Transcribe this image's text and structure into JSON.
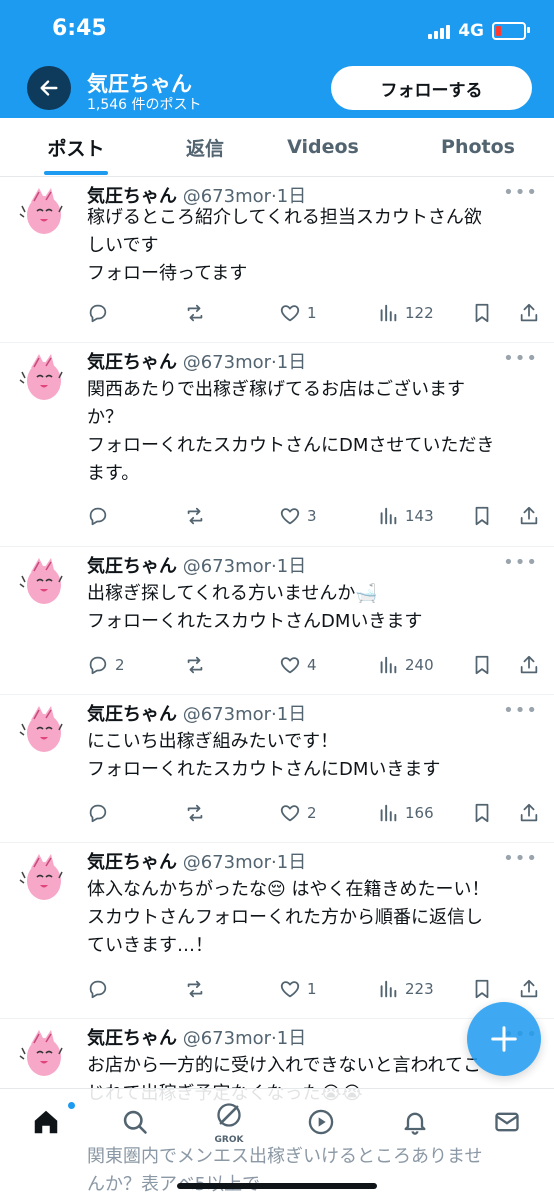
{
  "status_bar": {
    "time": "6:45",
    "network": "4G"
  },
  "header": {
    "name": "気圧ちゃん",
    "post_count": "1,546 件のポスト",
    "follow_label": "フォローする"
  },
  "tabs": [
    {
      "label": "ポスト"
    },
    {
      "label": "返信"
    },
    {
      "label": "Videos"
    },
    {
      "label": "Photos"
    }
  ],
  "posts": [
    {
      "name": "気圧ちゃん",
      "handle": "@673mor",
      "time": "1日",
      "more": "•••",
      "lines": [
        "稼げるところ紹介してくれる担当スカウトさん欲",
        "しいです",
        "フォロー待ってます"
      ],
      "replies": "",
      "reposts": "",
      "likes": "1",
      "views": "122"
    },
    {
      "name": "気圧ちゃん",
      "handle": "@673mor",
      "time": "1日",
      "more": "•••",
      "lines": [
        "関西あたりで出稼ぎ稼げてるお店はございます",
        "か？",
        "フォローくれたスカウトさんにDMさせていただき",
        "ます。"
      ],
      "replies": "",
      "reposts": "",
      "likes": "3",
      "views": "143"
    },
    {
      "name": "気圧ちゃん",
      "handle": "@673mor",
      "time": "1日",
      "more": "•••",
      "lines": [
        "出稼ぎ探してくれる方いませんか🛁",
        "フォローくれたスカウトさんDMいきます"
      ],
      "replies": "2",
      "reposts": "",
      "likes": "4",
      "views": "240"
    },
    {
      "name": "気圧ちゃん",
      "handle": "@673mor",
      "time": "1日",
      "more": "•••",
      "lines": [
        "にこいち出稼ぎ組みたいです！",
        "フォローくれたスカウトさんにDMいきます"
      ],
      "replies": "",
      "reposts": "",
      "likes": "2",
      "views": "166"
    },
    {
      "name": "気圧ちゃん",
      "handle": "@673mor",
      "time": "1日",
      "more": "•••",
      "lines": [
        "体入なんかちがったな😔 はやく在籍きめたーい！",
        "スカウトさんフォローくれた方から順番に返信し",
        "ていきます…！"
      ],
      "replies": "",
      "reposts": "",
      "likes": "1",
      "views": "223"
    },
    {
      "name": "気圧ちゃん",
      "handle": "@673mor",
      "time": "1日",
      "more": "•••",
      "lines": [
        "お店から一方的に受け入れできないと言われてこ",
        "じれて出稼ぎ予定なくなった😭😭"
      ]
    }
  ],
  "under_nav_text": [
    "関東圏内でメンエス出稼ぎいけるところありませ",
    "んか？表アベ5以上で"
  ],
  "bottom_nav": {
    "grok_label": "GROK"
  },
  "colors": {
    "accent": "#1d9bf0",
    "text": "#0f1419",
    "secondary": "#536471"
  }
}
